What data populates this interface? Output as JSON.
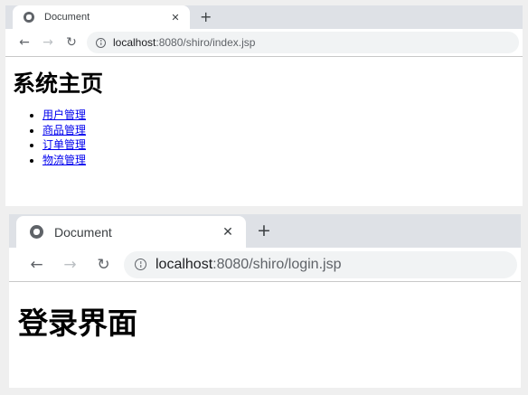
{
  "colors": {
    "tabstrip": "#dee1e6",
    "omnibox": "#f1f3f4",
    "link": "#0000ee",
    "backdrop": "#efefef"
  },
  "icons": {
    "favicon": "globe-icon",
    "close": "close-icon",
    "new_tab": "plus-icon",
    "back": "arrow-left-icon",
    "forward": "arrow-right-icon",
    "reload": "reload-icon",
    "site_info": "info-icon"
  },
  "window_top": {
    "tab_title": "Document",
    "url_host": "localhost",
    "url_rest": ":8080/shiro/index.jsp",
    "page": {
      "heading": "系统主页",
      "links": [
        {
          "label": "用户管理"
        },
        {
          "label": "商品管理"
        },
        {
          "label": "订单管理"
        },
        {
          "label": "物流管理"
        }
      ]
    }
  },
  "window_bottom": {
    "tab_title": "Document",
    "url_host": "localhost",
    "url_rest": ":8080/shiro/login.jsp",
    "page": {
      "heading": "登录界面"
    }
  }
}
